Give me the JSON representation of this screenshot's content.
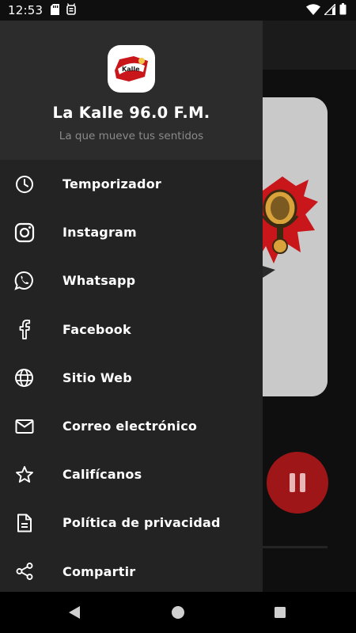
{
  "status_bar": {
    "time": "12:53"
  },
  "drawer": {
    "station_name": "La Kalle 96.0 F.M.",
    "tagline": "La que mueve tus sentidos",
    "logo_alt": "La Kalle",
    "menu": [
      {
        "label": "Temporizador",
        "icon": "clock-icon"
      },
      {
        "label": "Instagram",
        "icon": "instagram-icon"
      },
      {
        "label": "Whatsapp",
        "icon": "whatsapp-icon"
      },
      {
        "label": "Facebook",
        "icon": "facebook-icon"
      },
      {
        "label": "Sitio Web",
        "icon": "globe-icon"
      },
      {
        "label": "Correo electrónico",
        "icon": "mail-icon"
      },
      {
        "label": "Califícanos",
        "icon": "star-icon"
      },
      {
        "label": "Política de privacidad",
        "icon": "document-icon"
      },
      {
        "label": "Compartir",
        "icon": "share-icon"
      }
    ]
  },
  "player": {
    "state": "playing",
    "accent_color": "#9e1618"
  },
  "colors": {
    "drawer_bg": "#232323",
    "drawer_header_bg": "#2c2c2c",
    "text_primary": "#ffffff",
    "text_secondary": "#8b8b8b"
  }
}
